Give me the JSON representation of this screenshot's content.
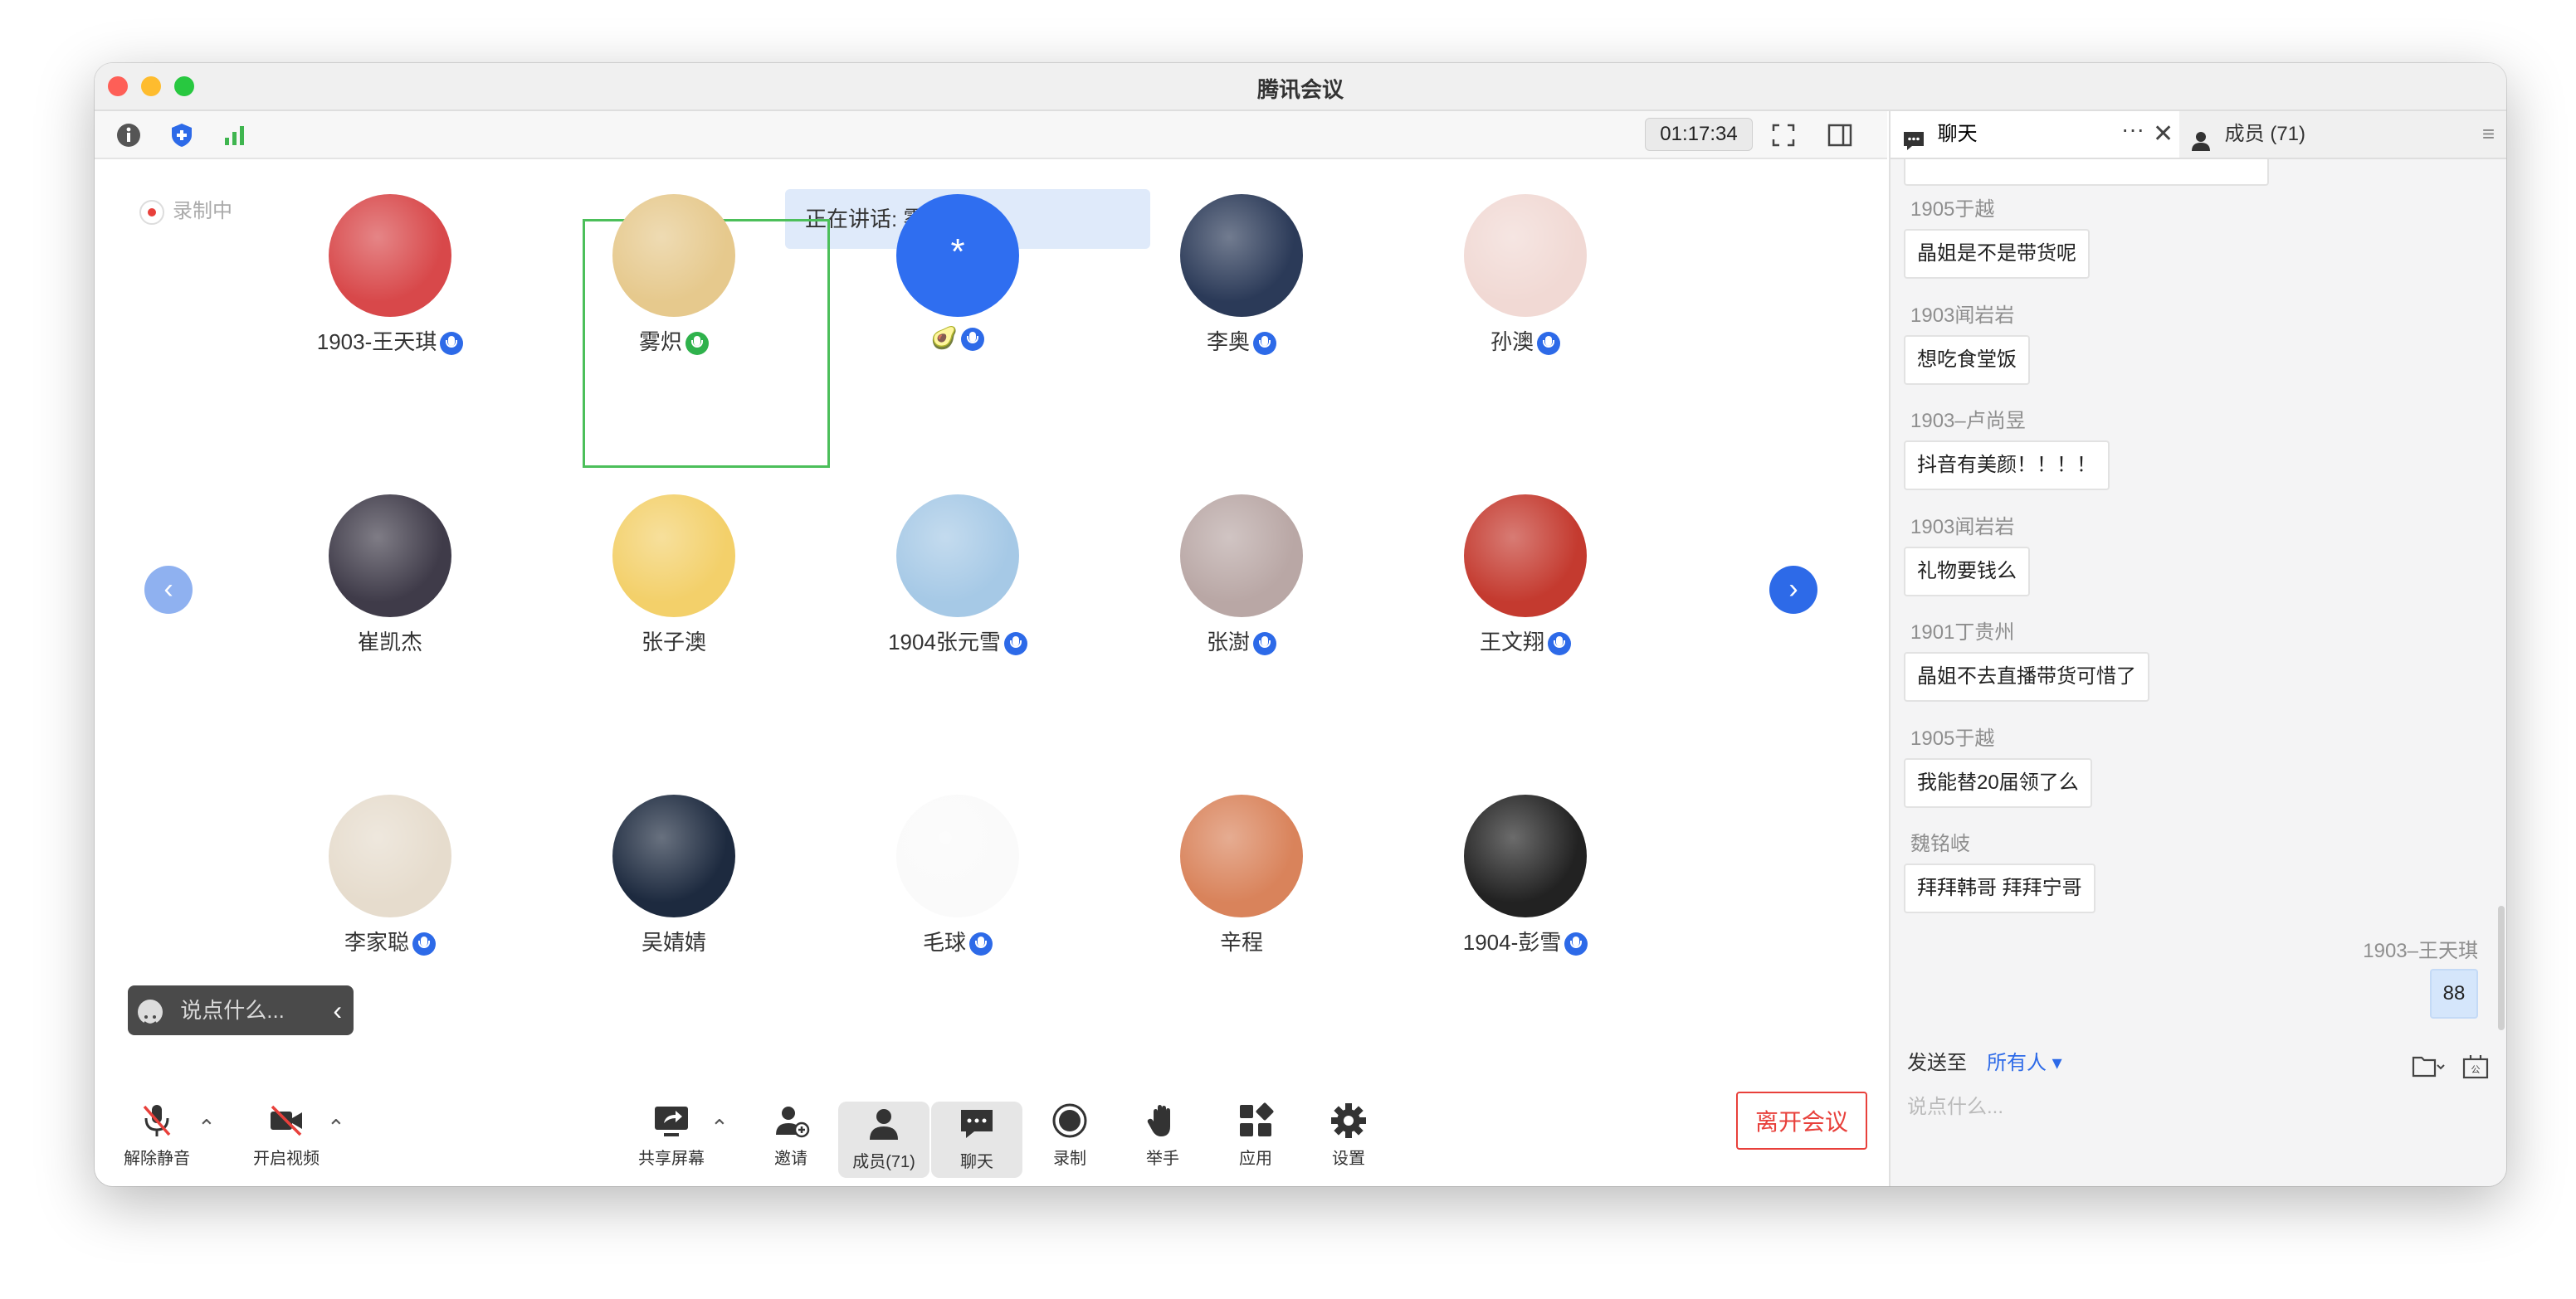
{
  "window": {
    "title": "腾讯会议"
  },
  "toolbar": {
    "timer": "01:17:34"
  },
  "status": {
    "recording": "录制中",
    "speaking": "正在讲话: 雾炽;"
  },
  "participants": [
    {
      "name": "1903-王天琪",
      "mic": "muted",
      "avatar_color": "#d8484a"
    },
    {
      "name": "雾炽",
      "mic": "active",
      "avatar_color": "#e6c98d"
    },
    {
      "name": "🥑",
      "mic": "muted",
      "avatar_color": "#2f6ef0",
      "avatar_text": "*"
    },
    {
      "name": "李奥",
      "mic": "muted",
      "avatar_color": "#2b3a58"
    },
    {
      "name": "孙澳",
      "mic": "muted",
      "avatar_color": "#f1d9d4"
    },
    {
      "name": "崔凯杰",
      "mic": "none",
      "avatar_color": "#3f3b49"
    },
    {
      "name": "张子澳",
      "mic": "none",
      "avatar_color": "#f3d06a"
    },
    {
      "name": "1904张元雪",
      "mic": "muted",
      "avatar_color": "#a6c9e6"
    },
    {
      "name": "张澍",
      "mic": "muted",
      "avatar_color": "#b9a7a5"
    },
    {
      "name": "王文翔",
      "mic": "muted",
      "avatar_color": "#c43a2f"
    },
    {
      "name": "李家聪",
      "mic": "muted",
      "avatar_color": "#e6dccd"
    },
    {
      "name": "吴婧婧",
      "mic": "none",
      "avatar_color": "#1d2a3f"
    },
    {
      "name": "毛球",
      "mic": "muted",
      "avatar_color": "#fafafa"
    },
    {
      "name": "辛程",
      "mic": "none",
      "avatar_color": "#d9835b"
    },
    {
      "name": "1904-彭雪",
      "mic": "muted",
      "avatar_color": "#222222"
    }
  ],
  "chat_input_pill": {
    "placeholder": "说点什么..."
  },
  "controls": {
    "unmute": "解除静音",
    "video": "开启视频",
    "share": "共享屏幕",
    "invite": "邀请",
    "members": "成员(71)",
    "chat": "聊天",
    "record": "录制",
    "raise": "举手",
    "apps": "应用",
    "settings": "设置",
    "leave": "离开会议"
  },
  "panel": {
    "chat_tab": "聊天",
    "members_tab": "成员 (71)",
    "messages": [
      {
        "sender": "1905于越",
        "text": "晶姐是不是带货呢"
      },
      {
        "sender": "1903闻岩岩",
        "text": "想吃食堂饭"
      },
      {
        "sender": "1903–卢尚昱",
        "text": "抖音有美颜！！！！"
      },
      {
        "sender": "1903闻岩岩",
        "text": "礼物要钱么"
      },
      {
        "sender": "1901丁贵州",
        "text": "晶姐不去直播带货可惜了"
      },
      {
        "sender": "1905于越",
        "text": "我能替20届领了么"
      },
      {
        "sender": "魏铭岐",
        "text": "拜拜韩哥 拜拜宁哥"
      }
    ],
    "own_message": {
      "sender": "1903–王天琪",
      "text": "88"
    },
    "send_to_label": "发送至",
    "send_to_value": "所有人",
    "input_placeholder": "说点什么..."
  },
  "colors": {
    "accent_blue": "#2d6ae8",
    "speaker_border": "#4cbf5a",
    "leave_red": "#e8403b"
  }
}
